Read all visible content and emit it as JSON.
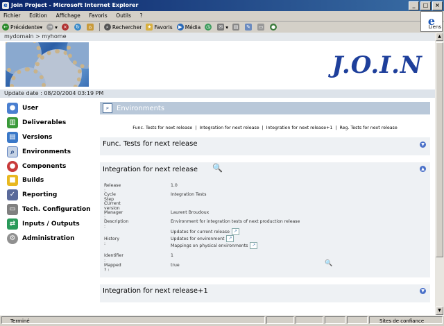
{
  "window": {
    "title": "Join Project - Microsoft Internet Explorer"
  },
  "menu": [
    "Fichier",
    "Edition",
    "Affichage",
    "Favoris",
    "Outils",
    "?"
  ],
  "toolbar": {
    "back": "Précédente",
    "search": "Rechercher",
    "favorites": "Favoris",
    "media": "Média",
    "links": "Liens"
  },
  "breadcrumb": "mydomain > myhome",
  "logo": {
    "text": "J.O.I.N"
  },
  "update_date": "Update date : 08/20/2004 03:19 PM",
  "sidebar": {
    "items": [
      {
        "label": "User",
        "icon": "user-icon",
        "color": "#4a7fd0"
      },
      {
        "label": "Deliverables",
        "icon": "deliverables-icon",
        "color": "#3a9a3a"
      },
      {
        "label": "Versions",
        "icon": "versions-icon",
        "color": "#3a78c8"
      },
      {
        "label": "Environments",
        "icon": "environments-icon",
        "color": "#7a8fb0",
        "active": true
      },
      {
        "label": "Components",
        "icon": "components-icon",
        "color": "#c83a3a"
      },
      {
        "label": "Builds",
        "icon": "builds-icon",
        "color": "#e8b820"
      },
      {
        "label": "Reporting",
        "icon": "reporting-icon",
        "color": "#5a6a9a"
      },
      {
        "label": "Tech. Configuration",
        "icon": "tech-config-icon",
        "color": "#808080"
      },
      {
        "label": "Inputs / Outputs",
        "icon": "inputs-outputs-icon",
        "color": "#2a9a5a"
      },
      {
        "label": "Administration",
        "icon": "administration-icon",
        "color": "#909090"
      }
    ]
  },
  "main": {
    "title": "Environments",
    "links": [
      "Func. Tests for next release",
      "Integration for next release",
      "Integration for next release+1",
      "Reg. Tests for next release"
    ],
    "panels": [
      {
        "title": "Func. Tests for next release"
      },
      {
        "title": "Integration for next release",
        "details": [
          {
            "label": "Release :",
            "value": "1.0"
          },
          {
            "label": "Cycle Step :",
            "value": "Integration Tests"
          },
          {
            "label": "CUrrent version :",
            "value": ""
          },
          {
            "label": "Manager :",
            "value": "Laurent Broudoux"
          },
          {
            "label": "Description :",
            "value": "Environment for integration tests of next production release"
          },
          {
            "label": "History :",
            "lines": [
              "Updates for current release",
              "Updates for environment",
              "Mappings on physical environments"
            ]
          },
          {
            "label": "Identifier :",
            "value": "1"
          },
          {
            "label": "Mapped ? :",
            "value": "true"
          }
        ]
      },
      {
        "title": "Integration for next release+1"
      }
    ]
  },
  "status": {
    "left": "Terminé",
    "zone": "Sites de confiance"
  }
}
